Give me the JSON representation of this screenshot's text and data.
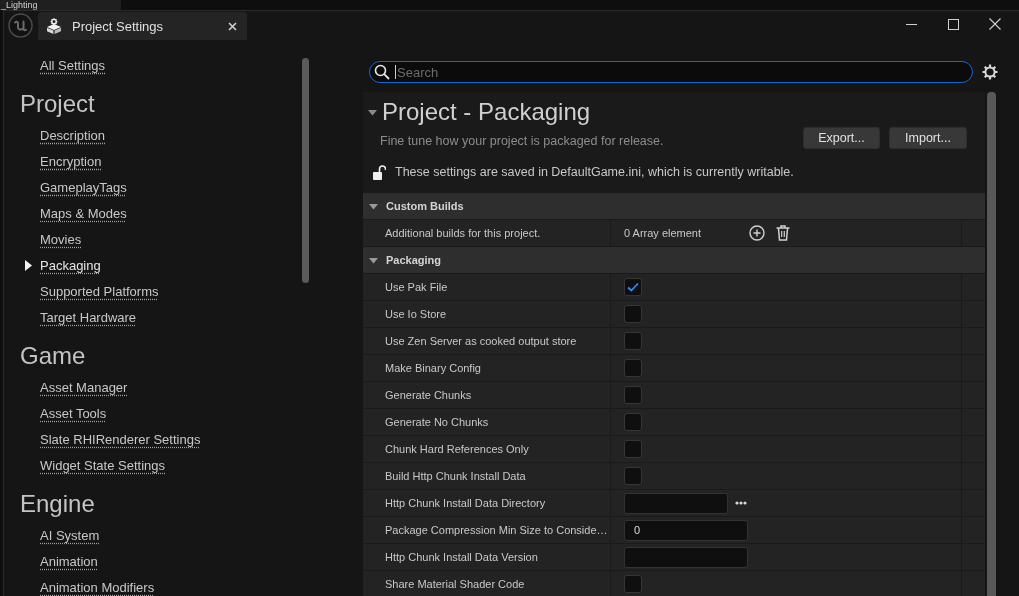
{
  "background_tab": {
    "title": "_Lighting"
  },
  "window": {
    "tab": {
      "title": "Project Settings"
    }
  },
  "sidebar": {
    "all_settings": "All Settings",
    "sections": [
      {
        "title": "Project",
        "items": [
          {
            "label": "Description",
            "selected": false
          },
          {
            "label": "Encryption",
            "selected": false
          },
          {
            "label": "GameplayTags",
            "selected": false
          },
          {
            "label": "Maps & Modes",
            "selected": false
          },
          {
            "label": "Movies",
            "selected": false
          },
          {
            "label": "Packaging",
            "selected": true
          },
          {
            "label": "Supported Platforms",
            "selected": false
          },
          {
            "label": "Target Hardware",
            "selected": false
          }
        ]
      },
      {
        "title": "Game",
        "items": [
          {
            "label": "Asset Manager",
            "selected": false
          },
          {
            "label": "Asset Tools",
            "selected": false
          },
          {
            "label": "Slate RHIRenderer Settings",
            "selected": false
          },
          {
            "label": "Widget State Settings",
            "selected": false
          }
        ]
      },
      {
        "title": "Engine",
        "items": [
          {
            "label": "AI System",
            "selected": false
          },
          {
            "label": "Animation",
            "selected": false
          },
          {
            "label": "Animation Modifiers",
            "selected": false
          }
        ]
      }
    ]
  },
  "search": {
    "placeholder": "Search",
    "focused": true
  },
  "details": {
    "title": "Project - Packaging",
    "expanded": true,
    "description": "Fine tune how your project is packaged for release.",
    "buttons": [
      "Export...",
      "Import..."
    ],
    "config_note": "These settings are saved in DefaultGame.ini, which is currently writable.",
    "categories": [
      {
        "title": "Custom Builds",
        "expanded": true,
        "rows": [
          {
            "kind": "array",
            "label": "Additional builds for this project.",
            "value": "0 Array element"
          }
        ]
      },
      {
        "title": "Packaging",
        "expanded": true,
        "rows": [
          {
            "kind": "checkbox",
            "label": "Use Pak File",
            "checked": true
          },
          {
            "kind": "checkbox",
            "label": "Use Io Store",
            "checked": false
          },
          {
            "kind": "checkbox",
            "label": "Use Zen Server as cooked output store",
            "checked": false
          },
          {
            "kind": "checkbox",
            "label": "Make Binary Config",
            "checked": false
          },
          {
            "kind": "checkbox",
            "label": "Generate Chunks",
            "checked": false
          },
          {
            "kind": "checkbox",
            "label": "Generate No Chunks",
            "checked": false
          },
          {
            "kind": "checkbox",
            "label": "Chunk Hard References Only",
            "checked": false
          },
          {
            "kind": "checkbox",
            "label": "Build Http Chunk Install Data",
            "checked": false
          },
          {
            "kind": "path",
            "label": "Http Chunk Install Data Directory"
          },
          {
            "kind": "number",
            "label": "Package Compression Min Size to Conside…",
            "value": "0"
          },
          {
            "kind": "text",
            "label": "Http Chunk Install Data Version"
          },
          {
            "kind": "checkbox",
            "label": "Share Material Shader Code",
            "checked": false
          }
        ]
      }
    ]
  }
}
